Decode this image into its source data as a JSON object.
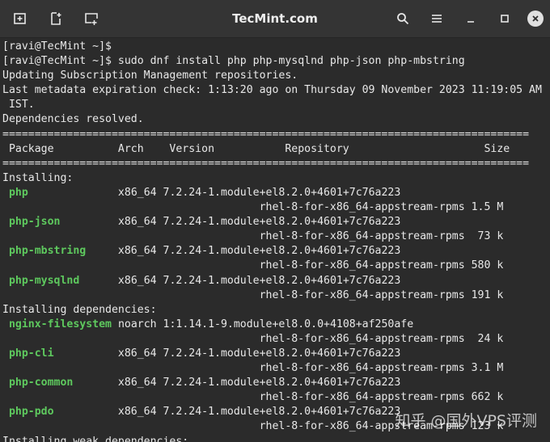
{
  "window": {
    "title": "TecMint.com",
    "toolbar_left": [
      "new-tab-icon",
      "split-pane-icon",
      "preferences-icon"
    ],
    "toolbar_right": [
      "search-icon",
      "hamburger-menu-icon",
      "minimize-icon",
      "maximize-icon",
      "close-icon"
    ]
  },
  "terminal": {
    "lines": [
      {
        "parts": [
          {
            "t": "[ravi@TecMint ~]$"
          }
        ]
      },
      {
        "parts": [
          {
            "t": "[ravi@TecMint ~]$ sudo dnf install php php-mysqlnd php-json php-mbstring"
          }
        ]
      },
      {
        "parts": [
          {
            "t": "Updating Subscription Management repositories."
          }
        ]
      },
      {
        "parts": [
          {
            "t": "Last metadata expiration check: 1:13:20 ago on Thursday 09 November 2023 11:19:05 AM"
          }
        ]
      },
      {
        "parts": [
          {
            "t": " IST."
          }
        ]
      },
      {
        "parts": [
          {
            "t": "Dependencies resolved."
          }
        ]
      },
      {
        "parts": [
          {
            "t": "=================================================================================="
          }
        ]
      },
      {
        "parts": [
          {
            "t": " Package          Arch    Version           Repository                     Size"
          }
        ]
      },
      {
        "parts": [
          {
            "t": "=================================================================================="
          }
        ]
      },
      {
        "parts": [
          {
            "t": "Installing:"
          }
        ]
      },
      {
        "parts": [
          {
            "t": " "
          },
          {
            "t": "php",
            "g": true
          },
          {
            "t": "              x86_64 7.2.24-1.module+el8.2.0+4601+7c76a223"
          }
        ]
      },
      {
        "parts": [
          {
            "t": "                                        rhel-8-for-x86_64-appstream-rpms 1.5 M"
          }
        ]
      },
      {
        "parts": [
          {
            "t": " "
          },
          {
            "t": "php-json",
            "g": true
          },
          {
            "t": "         x86_64 7.2.24-1.module+el8.2.0+4601+7c76a223"
          }
        ]
      },
      {
        "parts": [
          {
            "t": "                                        rhel-8-for-x86_64-appstream-rpms  73 k"
          }
        ]
      },
      {
        "parts": [
          {
            "t": " "
          },
          {
            "t": "php-mbstring",
            "g": true
          },
          {
            "t": "     x86_64 7.2.24-1.module+el8.2.0+4601+7c76a223"
          }
        ]
      },
      {
        "parts": [
          {
            "t": "                                        rhel-8-for-x86_64-appstream-rpms 580 k"
          }
        ]
      },
      {
        "parts": [
          {
            "t": " "
          },
          {
            "t": "php-mysqlnd",
            "g": true
          },
          {
            "t": "      x86_64 7.2.24-1.module+el8.2.0+4601+7c76a223"
          }
        ]
      },
      {
        "parts": [
          {
            "t": "                                        rhel-8-for-x86_64-appstream-rpms 191 k"
          }
        ]
      },
      {
        "parts": [
          {
            "t": "Installing dependencies:"
          }
        ]
      },
      {
        "parts": [
          {
            "t": " "
          },
          {
            "t": "nginx-filesystem",
            "g": true
          },
          {
            "t": " noarch 1:1.14.1-9.module+el8.0.0+4108+af250afe"
          }
        ]
      },
      {
        "parts": [
          {
            "t": "                                        rhel-8-for-x86_64-appstream-rpms  24 k"
          }
        ]
      },
      {
        "parts": [
          {
            "t": " "
          },
          {
            "t": "php-cli",
            "g": true
          },
          {
            "t": "          x86_64 7.2.24-1.module+el8.2.0+4601+7c76a223"
          }
        ]
      },
      {
        "parts": [
          {
            "t": "                                        rhel-8-for-x86_64-appstream-rpms 3.1 M"
          }
        ]
      },
      {
        "parts": [
          {
            "t": " "
          },
          {
            "t": "php-common",
            "g": true
          },
          {
            "t": "       x86_64 7.2.24-1.module+el8.2.0+4601+7c76a223"
          }
        ]
      },
      {
        "parts": [
          {
            "t": "                                        rhel-8-for-x86_64-appstream-rpms 662 k"
          }
        ]
      },
      {
        "parts": [
          {
            "t": " "
          },
          {
            "t": "php-pdo",
            "g": true
          },
          {
            "t": "          x86_64 7.2.24-1.module+el8.2.0+4601+7c76a223"
          }
        ]
      },
      {
        "parts": [
          {
            "t": "                                        rhel-8-for-x86_64-appstream-rpms 123 k"
          }
        ]
      },
      {
        "parts": [
          {
            "t": "Installing weak dependencies:"
          }
        ]
      }
    ]
  },
  "watermark": "知乎 @国外VPS评测"
}
